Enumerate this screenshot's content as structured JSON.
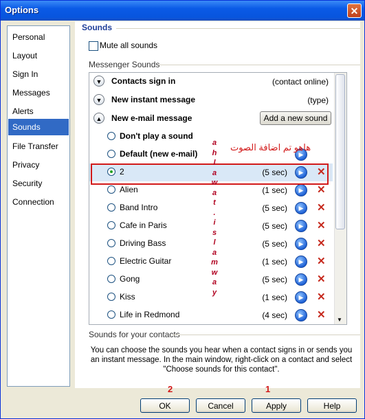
{
  "window": {
    "title": "Options",
    "close_glyph": "✕"
  },
  "nav": {
    "items": [
      {
        "label": "Personal"
      },
      {
        "label": "Layout"
      },
      {
        "label": "Sign In"
      },
      {
        "label": "Messages"
      },
      {
        "label": "Alerts"
      },
      {
        "label": "Sounds"
      },
      {
        "label": "File Transfer"
      },
      {
        "label": "Privacy"
      },
      {
        "label": "Security"
      },
      {
        "label": "Connection"
      }
    ],
    "selected": "Sounds"
  },
  "sounds": {
    "section_title": "Sounds",
    "mute_label": "Mute all sounds",
    "messenger_sounds_label": "Messenger Sounds",
    "events": [
      {
        "label": "Contacts sign in",
        "value": "(contact online)",
        "expanded": false
      },
      {
        "label": "New instant message",
        "value": "(type)",
        "expanded": false
      },
      {
        "label": "New e-mail message",
        "expanded": true,
        "add_button": "Add a new sound"
      }
    ],
    "options": [
      {
        "label": "Don't play a sound",
        "duration": "",
        "bold": true
      },
      {
        "label": "Default (new e-mail)",
        "duration": "",
        "bold": true
      },
      {
        "label": "2",
        "duration": "(5 sec)",
        "selected": true
      },
      {
        "label": "Alien",
        "duration": "(1 sec)"
      },
      {
        "label": "Band Intro",
        "duration": "(5 sec)"
      },
      {
        "label": "Cafe in Paris",
        "duration": "(5 sec)"
      },
      {
        "label": "Driving Bass",
        "duration": "(5 sec)"
      },
      {
        "label": "Electric Guitar",
        "duration": "(1 sec)"
      },
      {
        "label": "Gong",
        "duration": "(5 sec)"
      },
      {
        "label": "Kiss",
        "duration": "(1 sec)"
      },
      {
        "label": "Life in Redmond",
        "duration": "(4 sec)"
      }
    ],
    "contacts_label": "Sounds for your contacts",
    "description": "You can choose the sounds you hear when a contact signs in or sends you an instant message.  In the main window, right-click on a contact and select \"Choose sounds for this contact\"."
  },
  "annotations": {
    "arabic_note": "هاهو تم اضافة الصوت",
    "vertical_letters": [
      "a",
      "h",
      "l",
      "a",
      "w",
      "a",
      "t",
      ".",
      "i",
      "s",
      "l",
      "a",
      "m",
      "w",
      "a",
      "y"
    ],
    "number_ok": "2",
    "number_apply": "1",
    "highlight_color": "#d21919"
  },
  "buttons": {
    "ok": "OK",
    "cancel": "Cancel",
    "apply": "Apply",
    "help": "Help"
  },
  "icons": {
    "expand": "chevron-down-icon",
    "collapse": "chevron-up-icon",
    "play": "play-icon",
    "delete": "delete-x-icon"
  }
}
